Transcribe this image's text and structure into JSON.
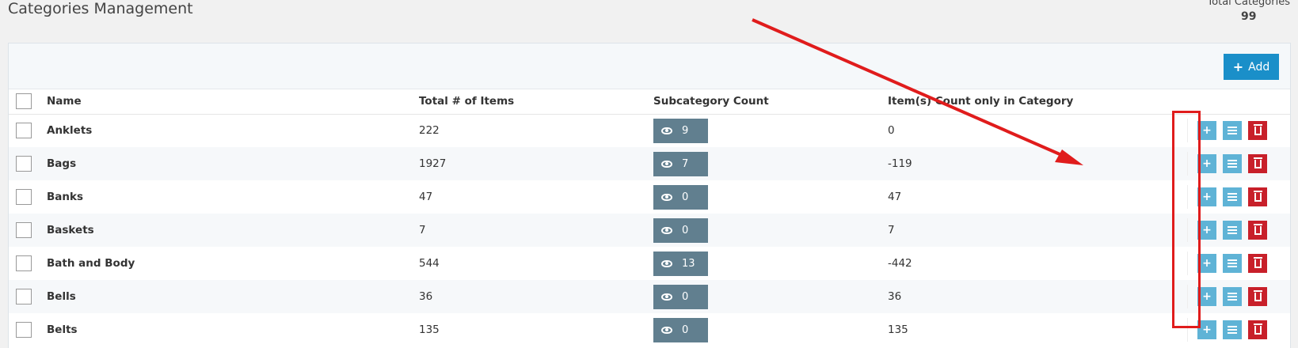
{
  "page": {
    "title": "Categories Management",
    "total_label": "Total Categories",
    "total_value": "99"
  },
  "toolbar": {
    "add_label": "Add"
  },
  "table": {
    "columns": [
      "Name",
      "Total # of Items",
      "Subcategory Count",
      "Item(s) Count only in Category"
    ],
    "rows": [
      {
        "name": "Anklets",
        "total": "222",
        "sub": "9",
        "only": "0"
      },
      {
        "name": "Bags",
        "total": "1927",
        "sub": "7",
        "only": "-119"
      },
      {
        "name": "Banks",
        "total": "47",
        "sub": "0",
        "only": "47"
      },
      {
        "name": "Baskets",
        "total": "7",
        "sub": "0",
        "only": "7"
      },
      {
        "name": "Bath and Body",
        "total": "544",
        "sub": "13",
        "only": "-442"
      },
      {
        "name": "Bells",
        "total": "36",
        "sub": "0",
        "only": "36"
      },
      {
        "name": "Belts",
        "total": "135",
        "sub": "0",
        "only": "135"
      }
    ]
  },
  "icons": {
    "add": "plus-icon",
    "list": "list-icon",
    "delete": "trash-icon",
    "view": "eye-icon"
  },
  "colors": {
    "primary": "#1a8fc9",
    "subcount_button": "#617f8f",
    "action_light": "#5fb3d6",
    "danger": "#c8202a",
    "annotation": "#e01c1c"
  }
}
